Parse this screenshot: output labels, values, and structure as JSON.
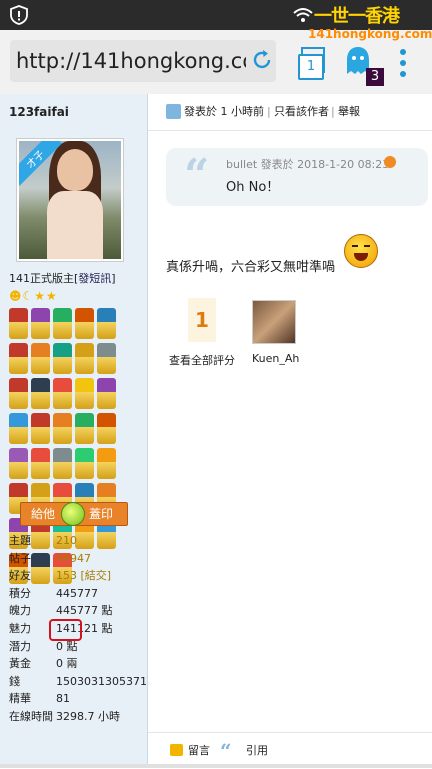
{
  "browser": {
    "url": "http://141hongkong.com",
    "tab_count": "1",
    "notification_count": "3"
  },
  "watermark": {
    "title": "一世一香港",
    "subtitle": "141hongkong.com"
  },
  "sidebar": {
    "username": "123faifai",
    "avatar_ribbon": "才子",
    "rank": "141正式版主",
    "send_message_link": "發短訊",
    "give_button": {
      "left": "給他",
      "right": "蓋印"
    },
    "stats": [
      {
        "label": "主題",
        "value": "210",
        "link": true
      },
      {
        "label": "帖子",
        "value": "44947",
        "link": true
      },
      {
        "label": "好友",
        "value": "153",
        "extra": "[結交]",
        "link": true
      },
      {
        "label": "積分",
        "value": "445777"
      },
      {
        "label": "魄力",
        "value": "445777 點"
      },
      {
        "label": "魅力",
        "value": "141121 點"
      },
      {
        "label": "潛力",
        "value": "0 點"
      },
      {
        "label": "黃金",
        "value": "0 兩"
      },
      {
        "label": "錢",
        "value": "1503031305371"
      },
      {
        "label": "精華",
        "value": "81"
      },
      {
        "label": "在線時間",
        "value": "3298.7 小時"
      }
    ],
    "medal_colors": [
      "#c0392b",
      "#8e44ad",
      "#27ae60",
      "#d35400",
      "#2980b9",
      "#c0392b",
      "#e67e22",
      "#16a085",
      "#d4a017",
      "#7f8c8d",
      "#c0392b",
      "#2c3e50",
      "#e74c3c",
      "#f1c40f",
      "#8e44ad",
      "#3498db",
      "#c0392b",
      "#e67e22",
      "#27ae60",
      "#d35400",
      "#9b59b6",
      "#e74c3c",
      "#7f8c8d",
      "#2ecc71",
      "#f39c12",
      "#c0392b",
      "#d4a017",
      "#e74c3c",
      "#2980b9",
      "#e67e22",
      "#8e44ad",
      "#c0392b",
      "#1abc9c",
      "#f39c12",
      "#3498db",
      "#d35400",
      "#2c3e50",
      "#e74c3c"
    ]
  },
  "post": {
    "posted_time": "發表於 1 小時前",
    "only_author": "只看該作者",
    "report": "舉報",
    "quote_meta": "bullet 發表於 2018-1-20 08:23",
    "quote_text": "Oh No！",
    "body": "真係升喎，六合彩又無咁準喎",
    "rating_count": "1",
    "view_all_ratings": "查看全部評分",
    "rater_name": "Kuen_Ah",
    "reply_label": "留言",
    "quote_label": "引用"
  }
}
